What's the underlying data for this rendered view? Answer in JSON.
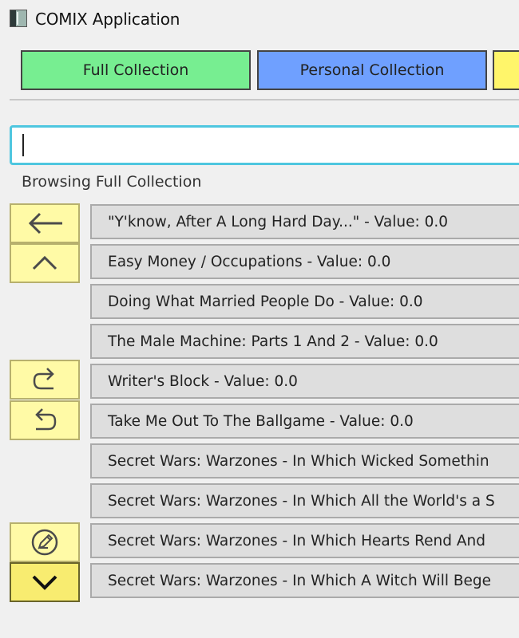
{
  "app": {
    "title": "COMIX Application",
    "icon": "app-window-icon"
  },
  "tabs": [
    {
      "label": "Full Collection",
      "color": "#77ee91"
    },
    {
      "label": "Personal Collection",
      "color": "#6fa0ff"
    },
    {
      "label": "",
      "color": "#fff56a"
    }
  ],
  "search": {
    "value": "",
    "placeholder": ""
  },
  "status": {
    "text": "Browsing Full Collection"
  },
  "side_buttons": [
    {
      "name": "back-arrow-icon"
    },
    {
      "name": "chevron-up-icon"
    },
    {
      "name": "redo-icon"
    },
    {
      "name": "undo-icon"
    },
    {
      "name": "edit-pencil-icon"
    },
    {
      "name": "chevron-down-icon"
    }
  ],
  "list": {
    "items": [
      {
        "label": "\"Y'know, After A Long Hard Day...\" - Value: 0.0"
      },
      {
        "label": "Easy Money / Occupations - Value: 0.0"
      },
      {
        "label": "Doing What Married People Do - Value: 0.0"
      },
      {
        "label": "The Male Machine: Parts 1 And 2 - Value: 0.0"
      },
      {
        "label": "Writer's Block - Value: 0.0"
      },
      {
        "label": "Take Me Out To The Ballgame - Value: 0.0"
      },
      {
        "label": "Secret Wars: Warzones - In Which Wicked Somethin"
      },
      {
        "label": "Secret Wars: Warzones - In Which All the World's a S"
      },
      {
        "label": "Secret Wars: Warzones - In Which Hearts Rend And"
      },
      {
        "label": "Secret Wars: Warzones - In Which A Witch Will Bege"
      }
    ]
  }
}
